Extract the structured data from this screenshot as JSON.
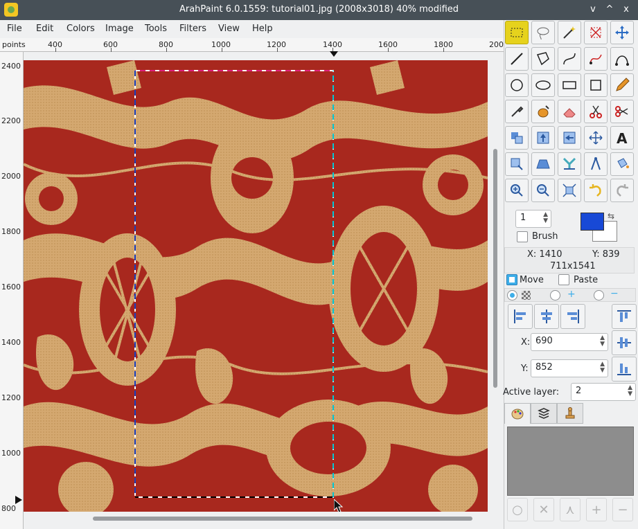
{
  "window": {
    "title": "ArahPaint 6.0.1559: tutorial01.jpg (2008x3018) 40% modified",
    "controls": [
      "v",
      "^",
      "x"
    ]
  },
  "menu": [
    "File",
    "Edit",
    "Colors",
    "Image",
    "Tools",
    "Filters",
    "View",
    "Help"
  ],
  "ruler": {
    "unit": "points",
    "top_labels": [
      "400",
      "600",
      "800",
      "1000",
      "1200",
      "1400",
      "1600",
      "1800",
      "200"
    ],
    "left_labels": [
      "2400",
      "2200",
      "2000",
      "1800",
      "1600",
      "1400",
      "1200",
      "1000",
      "800"
    ]
  },
  "tools": [
    "rect-select-icon",
    "lasso-icon",
    "magic-wand-icon",
    "crop-icon",
    "move-arrows-icon",
    "line-icon",
    "polygon-icon",
    "curve-icon",
    "freehand-curve-icon",
    "bezier-icon",
    "ellipse-icon",
    "oval-icon",
    "rectangle-icon",
    "square-icon",
    "pencil-icon",
    "eyedropper-icon",
    "fill-icon",
    "eraser-icon",
    "scissors-icon",
    "cut-icon",
    "clone-icon",
    "flip-vertical-icon",
    "flip-horizontal-icon",
    "resize-icon",
    "text-icon",
    "transform-icon",
    "perspective-icon",
    "symmetry-icon",
    "compass-icon",
    "bucket-icon",
    "zoom-in-icon",
    "zoom-out-icon",
    "fit-icon",
    "undo-icon",
    "redo-icon"
  ],
  "brush": {
    "size": "1",
    "brush_label": "Brush",
    "primary_color": "#1849d6",
    "secondary_color": "#ffffff"
  },
  "info": {
    "x_label": "X: 1410",
    "y_label": "Y: 839",
    "size_label": "711x1541"
  },
  "selection_mode": {
    "move_label": "Move",
    "paste_label": "Paste"
  },
  "position": {
    "x_label": "X:",
    "x_value": "690",
    "y_label": "Y:",
    "y_value": "852"
  },
  "layers": {
    "active_label": "Active layer:",
    "active_value": "2"
  },
  "colors": {
    "fabric_bg": "#d4a870",
    "pattern": "#a8281e",
    "title_bar": "#475057",
    "highlight": "#e6d21d"
  }
}
